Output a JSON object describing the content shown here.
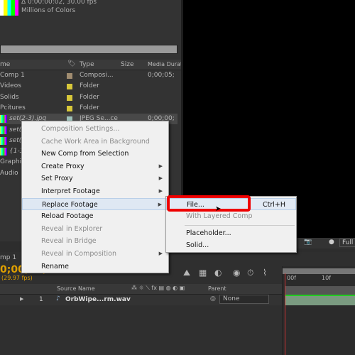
{
  "project": {
    "info": [
      "Δ 0:00:00:02, 30.00 fps",
      "Millions of Colors"
    ],
    "columns": [
      "me",
      "Type",
      "Size",
      "Media Duration"
    ],
    "rows": [
      {
        "name": "Comp 1",
        "type": "Composi...",
        "dur": "0;00;05;",
        "color": "#a08c70"
      },
      {
        "name": "Videos",
        "type": "Folder",
        "dur": "",
        "color": "#d8c83a"
      },
      {
        "name": "Solids",
        "type": "Folder",
        "dur": "",
        "color": "#d8c83a"
      },
      {
        "name": "Pcitures",
        "type": "Folder",
        "dur": "",
        "color": "#d8c83a"
      },
      {
        "name": "set(2-3).jpg",
        "type": "JPEG Se...ce",
        "dur": "0;00;00;",
        "color": "#9cc0b8"
      },
      {
        "name": "set(",
        "type": "",
        "dur": "",
        "color": ""
      },
      {
        "name": "set(",
        "type": "",
        "dur": "",
        "color": ""
      },
      {
        "name": "{1-3",
        "type": "",
        "dur": "",
        "color": ""
      },
      {
        "name": "Graphic",
        "type": "",
        "dur": "",
        "color": ""
      },
      {
        "name": "Audio",
        "type": "",
        "dur": "",
        "color": ""
      }
    ]
  },
  "context_menu": [
    {
      "label": "Composition Settings...",
      "disabled": true,
      "sub": false
    },
    {
      "label": "Cache Work Area in Background",
      "disabled": true,
      "sub": false
    },
    {
      "label": "New Comp from Selection",
      "disabled": false,
      "sub": false
    },
    {
      "label": "Create Proxy",
      "disabled": false,
      "sub": true
    },
    {
      "label": "Set Proxy",
      "disabled": false,
      "sub": true
    },
    {
      "label": "Interpret Footage",
      "disabled": false,
      "sub": true
    },
    {
      "label": "Replace Footage",
      "disabled": false,
      "sub": true,
      "highlighted": true
    },
    {
      "label": "Reload Footage",
      "disabled": false,
      "sub": false
    },
    {
      "label": "Reveal in Explorer",
      "disabled": true,
      "sub": false
    },
    {
      "label": "Reveal in Bridge",
      "disabled": true,
      "sub": false
    },
    {
      "label": "Reveal in Composition",
      "disabled": true,
      "sub": true
    },
    {
      "label": "Rename",
      "disabled": false,
      "sub": false
    }
  ],
  "submenu": {
    "file": "File...",
    "file_shortcut": "Ctrl+H",
    "layered": "With Layered Comp",
    "placeholder": "Placeholder...",
    "solid": "Solid..."
  },
  "viewer": {
    "resolution": "Full"
  },
  "timeline": {
    "tab": "mp 1",
    "timecode": "0;00;00;",
    "fps": "(29.97 fps)",
    "columns": {
      "source": "Source Name",
      "parent": "Parent"
    },
    "ruler": [
      "00f",
      "10f"
    ],
    "layer": {
      "index": "1",
      "name": "OrbWipe...rm.wav",
      "parent": "None"
    }
  }
}
